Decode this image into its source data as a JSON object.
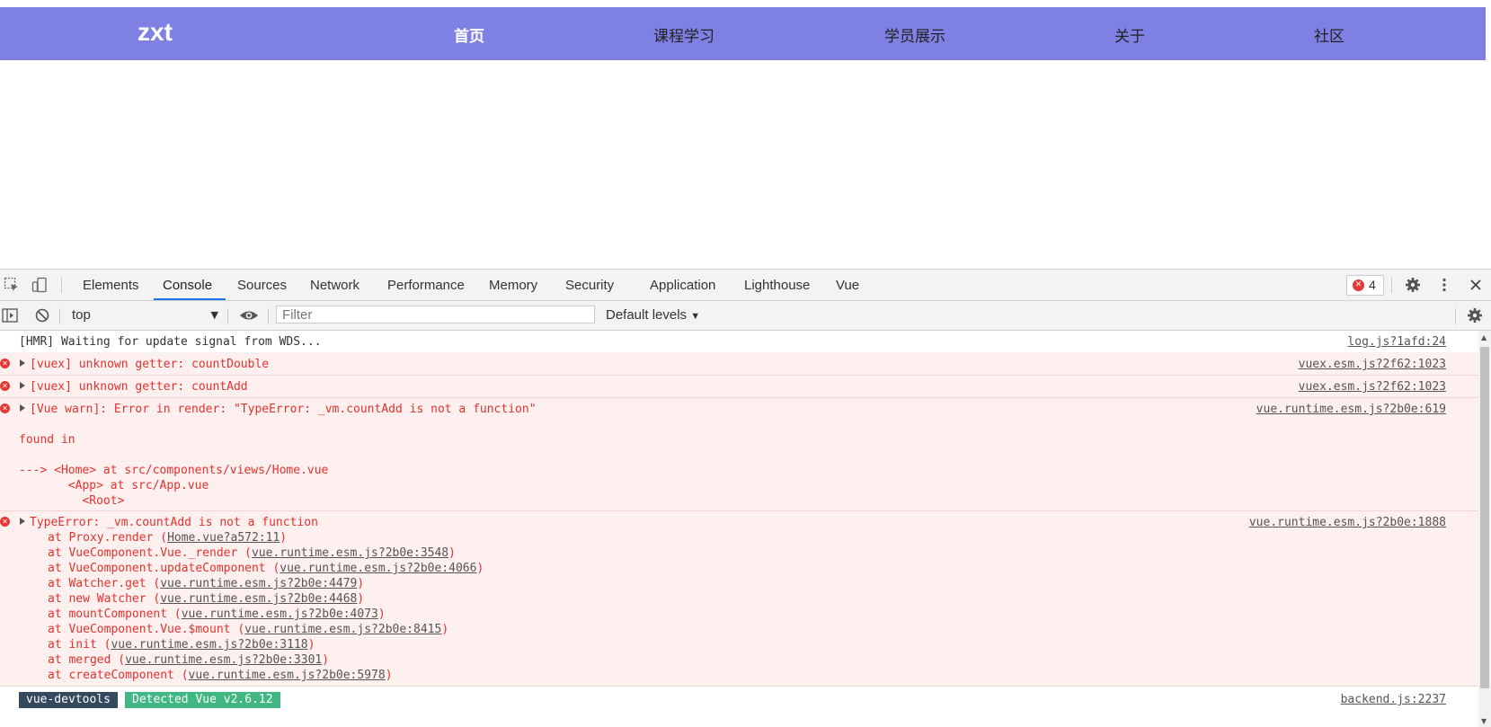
{
  "site": {
    "logo": "zxt",
    "nav": [
      {
        "label": "首页",
        "active": true
      },
      {
        "label": "课程学习",
        "active": false
      },
      {
        "label": "学员展示",
        "active": false
      },
      {
        "label": "关于",
        "active": false
      },
      {
        "label": "社区",
        "active": false
      }
    ],
    "header_color": "#7f80e4"
  },
  "devtools": {
    "tabs": [
      "Elements",
      "Console",
      "Sources",
      "Network",
      "Performance",
      "Memory",
      "Security",
      "Application",
      "Lighthouse",
      "Vue"
    ],
    "active_tab": "Console",
    "error_count": "4",
    "context": "top",
    "filter_placeholder": "Filter",
    "levels": "Default levels"
  },
  "console": {
    "hmr": {
      "text": "[HMR] Waiting for update signal from WDS...",
      "src": "log.js?1afd:24"
    },
    "err1": {
      "text": "[vuex] unknown getter: countDouble",
      "src": "vuex.esm.js?2f62:1023"
    },
    "err2": {
      "text": "[vuex] unknown getter: countAdd",
      "src": "vuex.esm.js?2f62:1023"
    },
    "err3": {
      "text": "[Vue warn]: Error in render: \"TypeError: _vm.countAdd is not a function\"",
      "src": "vue.runtime.esm.js?2b0e:619",
      "found": "found in",
      "trace": [
        "---> <Home> at src/components/views/Home.vue",
        "       <App> at src/App.vue",
        "         <Root>"
      ]
    },
    "err4": {
      "text": "TypeError: _vm.countAdd is not a function",
      "src": "vue.runtime.esm.js?2b0e:1888",
      "stack": [
        {
          "fn": "at Proxy.render (",
          "link": "Home.vue?a572:11",
          "end": ")"
        },
        {
          "fn": "at VueComponent.Vue._render (",
          "link": "vue.runtime.esm.js?2b0e:3548",
          "end": ")"
        },
        {
          "fn": "at VueComponent.updateComponent (",
          "link": "vue.runtime.esm.js?2b0e:4066",
          "end": ")"
        },
        {
          "fn": "at Watcher.get (",
          "link": "vue.runtime.esm.js?2b0e:4479",
          "end": ")"
        },
        {
          "fn": "at new Watcher (",
          "link": "vue.runtime.esm.js?2b0e:4468",
          "end": ")"
        },
        {
          "fn": "at mountComponent (",
          "link": "vue.runtime.esm.js?2b0e:4073",
          "end": ")"
        },
        {
          "fn": "at VueComponent.Vue.$mount (",
          "link": "vue.runtime.esm.js?2b0e:8415",
          "end": ")"
        },
        {
          "fn": "at init (",
          "link": "vue.runtime.esm.js?2b0e:3118",
          "end": ")"
        },
        {
          "fn": "at merged (",
          "link": "vue.runtime.esm.js?2b0e:3301",
          "end": ")"
        },
        {
          "fn": "at createComponent (",
          "link": "vue.runtime.esm.js?2b0e:5978",
          "end": ")"
        }
      ]
    },
    "devtools_badge": "vue-devtools",
    "detected_badge": "Detected Vue v2.6.12",
    "backend_src": "backend.js:2237"
  }
}
